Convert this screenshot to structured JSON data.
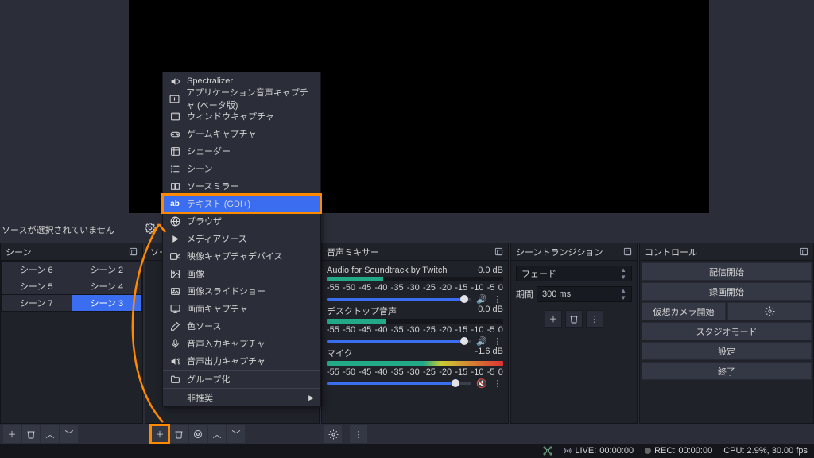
{
  "no_selection": "ソースが選択されていません",
  "panels": {
    "scenes": "シーン",
    "sources": "ソース",
    "mixer": "音声ミキサー",
    "trans": "シーントランジション",
    "ctrl": "コントロール"
  },
  "scenes": [
    {
      "label": "シーン 6"
    },
    {
      "label": "シーン 2"
    },
    {
      "label": "シーン 5"
    },
    {
      "label": "シーン 4"
    },
    {
      "label": "シーン 7"
    },
    {
      "label": "シーン 3",
      "sel": true
    }
  ],
  "mixer_ticks": [
    "-55",
    "-50",
    "-45",
    "-40",
    "-35",
    "-30",
    "-25",
    "-20",
    "-15",
    "-10",
    "-5",
    "0"
  ],
  "mixer": [
    {
      "name": "Audio for Soundtrack by Twitch",
      "db": "0.0 dB",
      "vol": "92%",
      "fill": "32%",
      "muted": false
    },
    {
      "name": "デスクトップ音声",
      "db": "0.0 dB",
      "vol": "92%",
      "fill": "34%",
      "muted": false
    },
    {
      "name": "マイク",
      "db": "-1.6 dB",
      "vol": "86%",
      "fill": "100%",
      "muted": true
    }
  ],
  "trans": {
    "type": "フェード",
    "dur_label": "期間",
    "dur": "300 ms"
  },
  "controls": {
    "stream": "配信開始",
    "record": "録画開始",
    "vcam": "仮想カメラ開始",
    "studio": "スタジオモード",
    "settings": "設定",
    "exit": "終了"
  },
  "menu": [
    {
      "icon": "vol",
      "label": "Spectralizer"
    },
    {
      "icon": "app",
      "label": "アプリケーション音声キャプチャ (ベータ版)"
    },
    {
      "icon": "win",
      "label": "ウィンドウキャプチャ"
    },
    {
      "icon": "pad",
      "label": "ゲームキャプチャ"
    },
    {
      "icon": "fx",
      "label": "シェーダー"
    },
    {
      "icon": "list",
      "label": "シーン"
    },
    {
      "icon": "mir",
      "label": "ソースミラー"
    },
    {
      "icon": "ab",
      "label": "テキスト (GDI+)",
      "hl": true
    },
    {
      "icon": "globe",
      "label": "ブラウザ"
    },
    {
      "icon": "play",
      "label": "メディアソース"
    },
    {
      "icon": "cam",
      "label": "映像キャプチャデバイス"
    },
    {
      "icon": "img",
      "label": "画像"
    },
    {
      "icon": "slide",
      "label": "画像スライドショー"
    },
    {
      "icon": "mon",
      "label": "画面キャプチャ"
    },
    {
      "icon": "brush",
      "label": "色ソース"
    },
    {
      "icon": "micin",
      "label": "音声入力キャプチャ"
    },
    {
      "icon": "micout",
      "label": "音声出力キャプチャ"
    },
    {
      "sep": true
    },
    {
      "icon": "folder",
      "label": "グループ化"
    },
    {
      "sep": true
    },
    {
      "label": "非推奨",
      "sub": true
    }
  ],
  "status": {
    "live_lbl": "LIVE:",
    "live": "00:00:00",
    "rec_lbl": "REC:",
    "rec": "00:00:00",
    "cpu": "CPU: 2.9%, 30.00 fps"
  }
}
